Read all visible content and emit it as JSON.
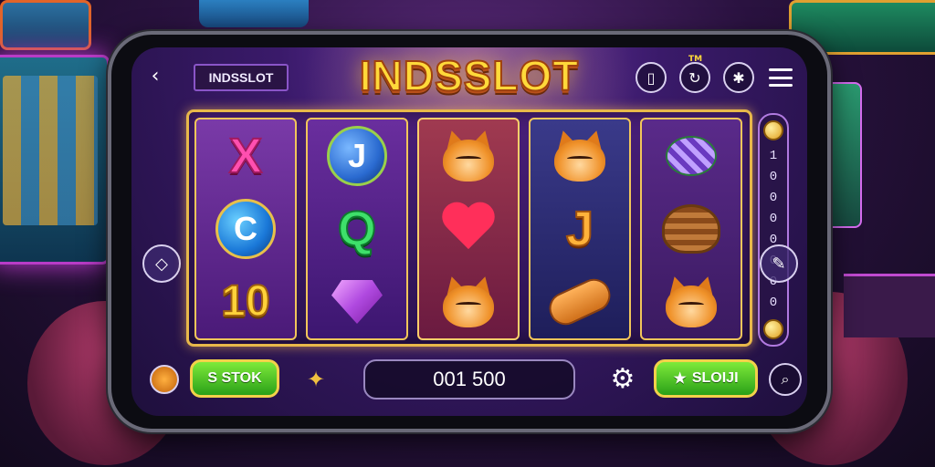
{
  "header": {
    "brand_badge": "INDSSLOT",
    "logo_text": "INDSSLOT",
    "logo_tm": "TM"
  },
  "icons": {
    "back": "chevron-left-icon",
    "top_right": [
      "phone-icon",
      "refresh-icon",
      "star-badge-icon",
      "menu-icon"
    ],
    "side_left": "arrow-icon",
    "side_right": "wand-icon",
    "bottom_left": "orb-icon",
    "puzzle": "puzzle-icon",
    "gear": "gear-icon",
    "search": "search-icon"
  },
  "reels": [
    [
      "X",
      "coin-C",
      "10"
    ],
    [
      "coin-J",
      "Q",
      "gem"
    ],
    [
      "cat",
      "heart",
      "cat"
    ],
    [
      "cat",
      "J",
      "bread"
    ],
    [
      "candy",
      "basket",
      "cat"
    ]
  ],
  "paytable": {
    "digits": [
      "1",
      "0",
      "0",
      "0",
      "0",
      "0",
      "0",
      "0"
    ]
  },
  "controls": {
    "left_button": "S STOK",
    "balance": "001 500",
    "right_button": "SLOIJI"
  },
  "colors": {
    "accent_gold": "#ffd93a",
    "button_green": "#2aa018",
    "screen_purple": "#3a1a6a"
  }
}
